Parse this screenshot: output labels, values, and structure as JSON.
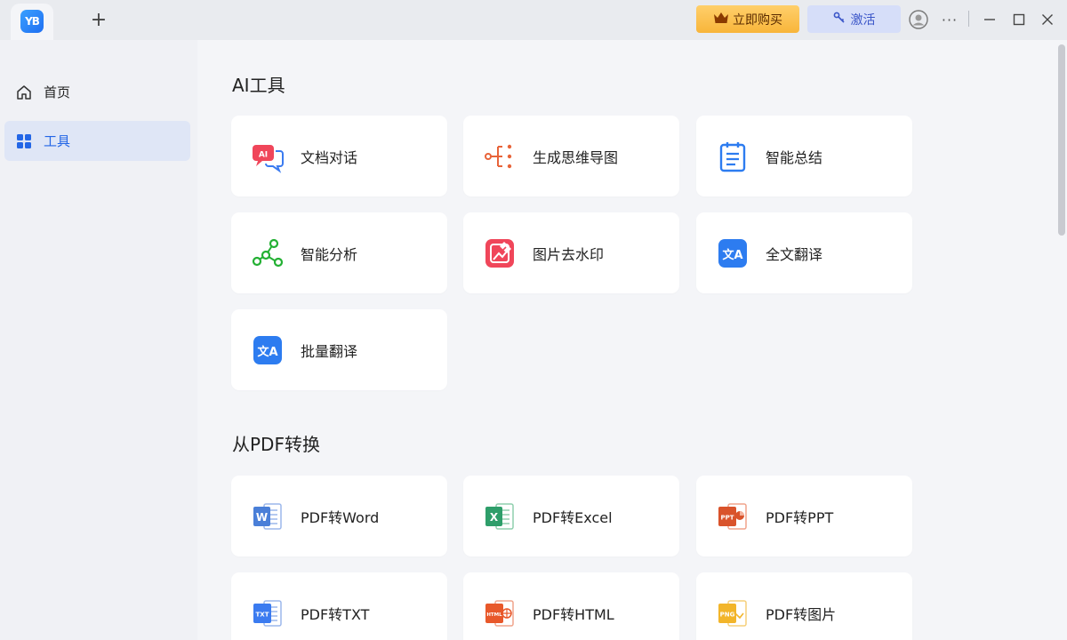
{
  "titlebar": {
    "app_logo_text": "YB",
    "new_tab_label": "+",
    "buy_label": "立即购买",
    "activate_label": "激活",
    "more_label": "···",
    "minimize_label": "—",
    "close_label": "✕"
  },
  "sidebar": {
    "items": [
      {
        "label": "首页",
        "icon": "home-icon"
      },
      {
        "label": "工具",
        "icon": "grid-apps-icon",
        "active": true
      }
    ]
  },
  "sections": [
    {
      "title": "AI工具",
      "cards": [
        {
          "label": "文档对话",
          "icon": "ai-chat-icon",
          "icon_text": "AI"
        },
        {
          "label": "生成思维导图",
          "icon": "mindmap-icon"
        },
        {
          "label": "智能总结",
          "icon": "summary-icon"
        },
        {
          "label": "智能分析",
          "icon": "analysis-icon"
        },
        {
          "label": "图片去水印",
          "icon": "remove-watermark-icon"
        },
        {
          "label": "全文翻译",
          "icon": "translate-icon",
          "icon_text": "文A"
        },
        {
          "label": "批量翻译",
          "icon": "batch-translate-icon",
          "icon_text": "文A"
        }
      ]
    },
    {
      "title": "从PDF转换",
      "cards": [
        {
          "label": "PDF转Word",
          "icon": "word-icon",
          "icon_text": "W"
        },
        {
          "label": "PDF转Excel",
          "icon": "excel-icon",
          "icon_text": "X"
        },
        {
          "label": "PDF转PPT",
          "icon": "ppt-icon",
          "icon_text": "PPT"
        },
        {
          "label": "PDF转TXT",
          "icon": "txt-icon",
          "icon_text": "TXT"
        },
        {
          "label": "PDF转HTML",
          "icon": "html-icon",
          "icon_text": "HTML"
        },
        {
          "label": "PDF转图片",
          "icon": "image-icon",
          "icon_text": "PNG"
        }
      ]
    }
  ],
  "colors": {
    "accent": "#2366e6",
    "buy_gold": "#f8b53a",
    "activate_bg": "#d6def9",
    "word_blue": "#4a7fd8",
    "excel_green": "#2e9e6a",
    "ppt_red": "#d9532b",
    "html_orange": "#e8582a",
    "png_yellow": "#f2b52a"
  }
}
